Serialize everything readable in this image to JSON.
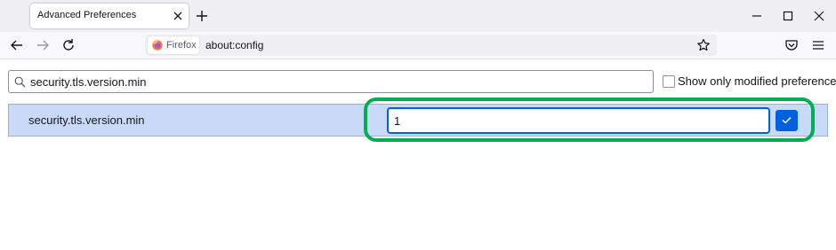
{
  "browser": {
    "tab_title": "Advanced Preferences",
    "identity_label": "Firefox",
    "url": "about:config"
  },
  "config": {
    "search_value": "security.tls.version.min",
    "show_modified_label": "Show only modified preferences",
    "show_modified_checked": false,
    "pref_name": "security.tls.version.min",
    "pref_edit_value": "1"
  },
  "colors": {
    "accent": "#0061e0",
    "row_selected": "#c9daf8",
    "highlight": "#00b050"
  },
  "icons": [
    "close-icon",
    "plus-icon",
    "minimize-icon",
    "maximize-icon",
    "back-arrow-icon",
    "forward-arrow-icon",
    "reload-icon",
    "firefox-logo-icon",
    "bookmark-star-icon",
    "pocket-icon",
    "hamburger-menu-icon",
    "search-icon",
    "checkmark-icon"
  ]
}
